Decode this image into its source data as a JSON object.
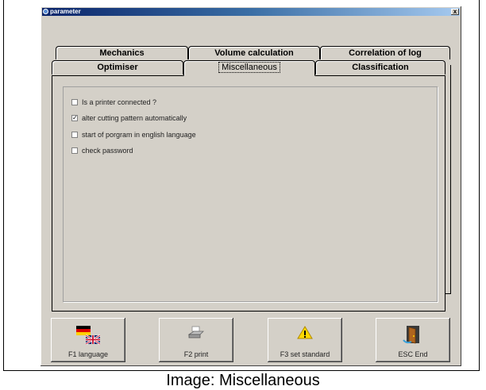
{
  "window": {
    "title": "parameter",
    "close_label": "x"
  },
  "tabs_back": [
    {
      "label": "Mechanics"
    },
    {
      "label": "Volume calculation"
    },
    {
      "label": "Correlation of log"
    }
  ],
  "tabs_front": [
    {
      "label": "Optimiser"
    },
    {
      "label": "Miscellaneous",
      "active": true
    },
    {
      "label": "Classification"
    }
  ],
  "options": [
    {
      "label": "Is a printer connected ?",
      "checked": false,
      "mark": ""
    },
    {
      "label": "alter cutting pattern automatically",
      "checked": true,
      "mark": "✓"
    },
    {
      "label": "start of porgram in english language",
      "checked": false,
      "mark": ""
    },
    {
      "label": "check password",
      "checked": false,
      "mark": ""
    }
  ],
  "function_keys": [
    {
      "label": "F1 language",
      "icon": "flags-icon"
    },
    {
      "label": "F2 print",
      "icon": "printer-icon"
    },
    {
      "label": "F3 set standard",
      "icon": "warning-icon"
    },
    {
      "label": "ESC End",
      "icon": "door-exit-icon"
    }
  ],
  "caption": "Image: Miscellaneous",
  "colors": {
    "dialog_bg": "#d4d0c8",
    "titlebar": "#0a246a"
  }
}
